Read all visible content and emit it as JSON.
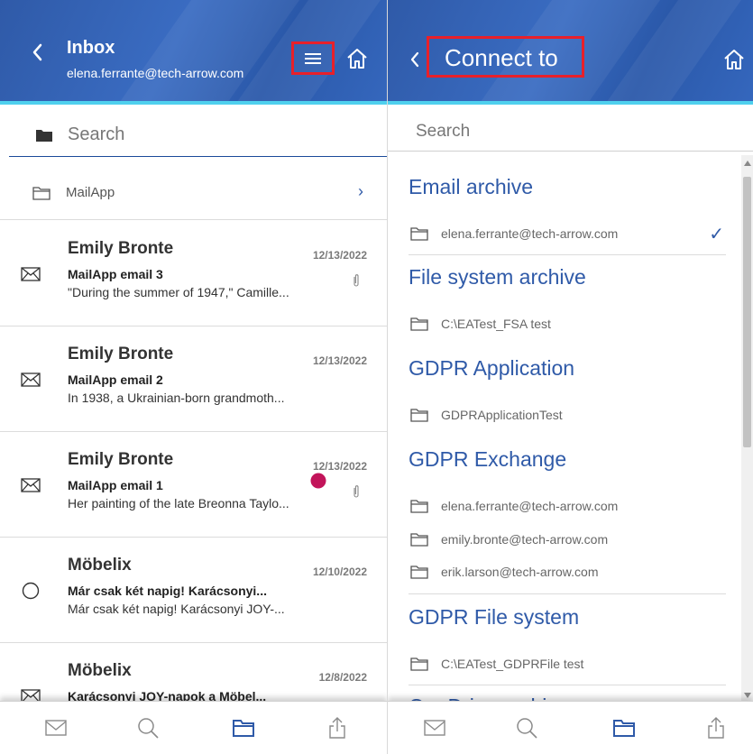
{
  "left": {
    "header": {
      "back_icon": "chevron-left-icon",
      "title": "Inbox",
      "account": "elena.ferrante@tech-arrow.com",
      "menu_icon": "hamburger-menu-icon",
      "home_icon": "home-icon"
    },
    "search": {
      "placeholder": "Search",
      "icon": "folder-icon"
    },
    "folder": {
      "label": "MailApp",
      "chevron": "›"
    },
    "emails": [
      {
        "sender": "Emily Bronte",
        "date": "12/13/2022",
        "subject": "MailApp email 3",
        "preview": "\"During the summer of 1947,\" Camille...",
        "icon": "envelope-icon",
        "attachment": true,
        "unread_dot": false
      },
      {
        "sender": "Emily Bronte",
        "date": "12/13/2022",
        "subject": "MailApp email 2",
        "preview": "In 1938, a Ukrainian-born grandmoth...",
        "icon": "envelope-icon",
        "attachment": false,
        "unread_dot": false
      },
      {
        "sender": "Emily Bronte",
        "date": "12/13/2022",
        "subject": "MailApp email 1",
        "preview": "Her painting of the late Breonna Taylo...",
        "icon": "envelope-icon",
        "attachment": true,
        "unread_dot": true
      },
      {
        "sender": "Möbelix",
        "date": "12/10/2022",
        "subject": "Már csak két napig! Karácsonyi...",
        "preview": "Már csak két napig! Karácsonyi JOY-...",
        "icon": "circle-icon",
        "attachment": false,
        "unread_dot": false
      },
      {
        "sender": "Möbelix",
        "date": "12/8/2022",
        "subject": "Karácsonyi JOY-napok a Möbel...",
        "preview": "",
        "icon": "envelope-icon",
        "attachment": false,
        "unread_dot": false
      }
    ],
    "bottom_nav": [
      "mail-icon",
      "search-icon",
      "folder-icon",
      "share-icon"
    ]
  },
  "right": {
    "header": {
      "back_icon": "chevron-left-icon",
      "title": "Connect to",
      "home_icon": "home-icon"
    },
    "search": {
      "placeholder": "Search"
    },
    "sections": [
      {
        "title": "Email archive",
        "items": [
          {
            "label": "elena.ferrante@tech-arrow.com",
            "checked": true
          }
        ]
      },
      {
        "title": "File system archive",
        "items": [
          {
            "label": "C:\\EATest_FSA test",
            "checked": false
          }
        ]
      },
      {
        "title": "GDPR Application",
        "items": [
          {
            "label": "GDPRApplicationTest",
            "checked": false
          }
        ]
      },
      {
        "title": "GDPR Exchange",
        "items": [
          {
            "label": "elena.ferrante@tech-arrow.com",
            "checked": false
          },
          {
            "label": "emily.bronte@tech-arrow.com",
            "checked": false
          },
          {
            "label": "erik.larson@tech-arrow.com",
            "checked": false
          }
        ]
      },
      {
        "title": "GDPR File system",
        "items": [
          {
            "label": "C:\\EATest_GDPRFile test",
            "checked": false
          }
        ]
      },
      {
        "title": "OneDrive archive",
        "items": []
      }
    ],
    "check_mark": "✓",
    "bottom_nav": [
      "mail-icon",
      "search-icon",
      "folder-icon",
      "share-icon"
    ]
  },
  "colors": {
    "header_blue": "#2f5aa8",
    "accent_cyan": "#4fd0ee",
    "highlight_red": "#e8202a",
    "unread_dot": "#c2145a",
    "section_title": "#2f5aa8"
  }
}
